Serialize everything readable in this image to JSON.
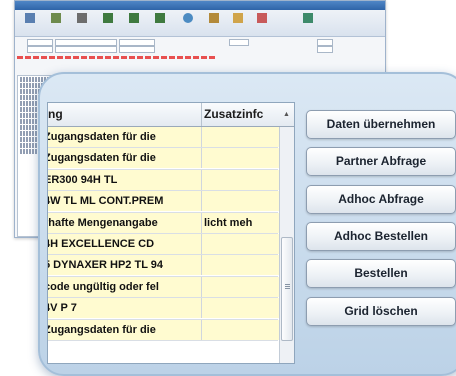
{
  "background_window": {
    "toolbar_icons": [
      "document-icon",
      "grid-icon",
      "print-icon",
      "table-icon",
      "table-icon",
      "table-icon",
      "refresh-icon",
      "box-icon",
      "folder-icon",
      "calendar-icon",
      "exit-icon"
    ]
  },
  "grid": {
    "columns": [
      "ng",
      "Zusatzinfc"
    ],
    "sort_indicator": "▲",
    "rows": [
      {
        "c1": "Zugangsdaten für die",
        "c2": ""
      },
      {
        "c1": "Zugangsdaten für die",
        "c2": ""
      },
      {
        "c1": "ER300 94H TL",
        "c2": ""
      },
      {
        "c1": "4W TL ML CONT.PREM",
        "c2": ""
      },
      {
        "c1": "rhafte Mengenangabe",
        "c2": "licht meh"
      },
      {
        "c1": "4H EXCELLENCE CD",
        "c2": ""
      },
      {
        "c1": "5 DYNAXER HP2 TL 94",
        "c2": ""
      },
      {
        "c1": "code ungültig oder fel",
        "c2": ""
      },
      {
        "c1": "4V P 7",
        "c2": ""
      },
      {
        "c1": "Zugangsdaten für die",
        "c2": ""
      }
    ]
  },
  "buttons": [
    "Daten übernehmen",
    "Partner Abfrage",
    "Adhoc Abfrage",
    "Adhoc Bestellen",
    "Bestellen",
    "Grid löschen"
  ]
}
